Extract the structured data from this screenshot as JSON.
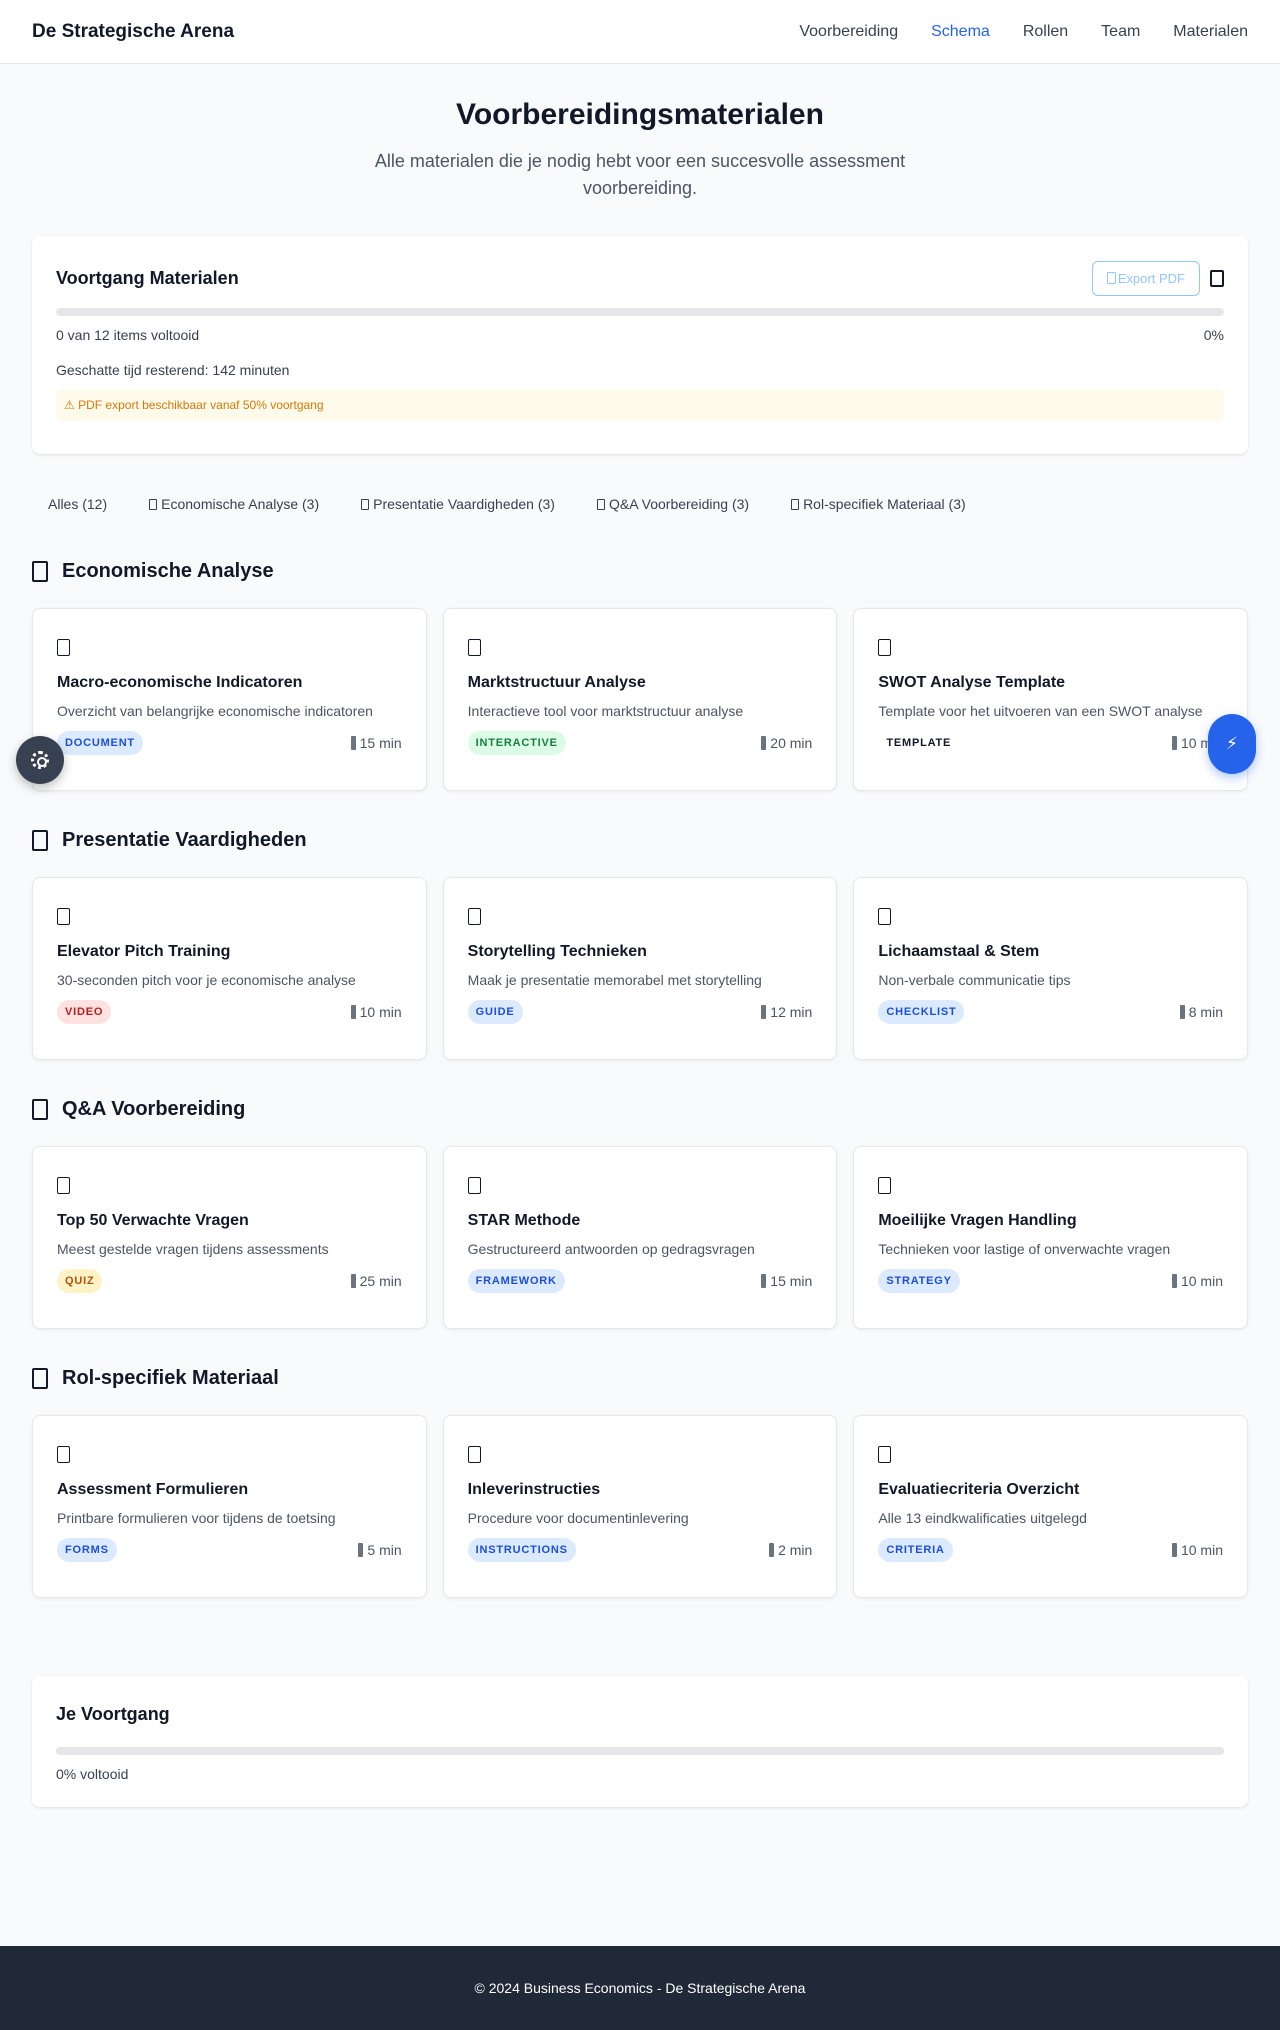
{
  "navbar": {
    "brand": "De Strategische Arena",
    "links": [
      {
        "label": "Voorbereiding"
      },
      {
        "label": "Schema"
      },
      {
        "label": "Rollen"
      },
      {
        "label": "Team"
      },
      {
        "label": "Materialen"
      }
    ],
    "active_link": "Schema"
  },
  "header": {
    "title": "Voorbereidingsmaterialen",
    "subtitle": "Alle materialen die je nodig hebt voor een succesvolle assessment voorbereiding."
  },
  "progress_panel": {
    "title": "Voortgang Materialen",
    "export_label": "Export PDF",
    "progress_fraction": 0,
    "items_text": "0 van 12 items voltooid",
    "percent_text": "0%",
    "time_text": "Geschatte tijd resterend: 142 minuten",
    "warning": "⚠ PDF export beschikbaar vanaf 50% voortgang"
  },
  "filters": [
    {
      "label": "Alles (12)",
      "icon": false
    },
    {
      "label": "Economische Analyse (3)",
      "icon": true
    },
    {
      "label": "Presentatie Vaardigheden (3)",
      "icon": true
    },
    {
      "label": "Q&A Voorbereiding (3)",
      "icon": true
    },
    {
      "label": "Rol-specifiek Materiaal (3)",
      "icon": true
    }
  ],
  "sections": [
    {
      "title": "Economische Analyse",
      "cards": [
        {
          "title": "Macro-economische Indicatoren",
          "desc": "Overzicht van belangrijke economische indicatoren",
          "badge": "DOCUMENT",
          "badge_color": "blue",
          "duration": "15 min"
        },
        {
          "title": "Marktstructuur Analyse",
          "desc": "Interactieve tool voor marktstructuur analyse",
          "badge": "INTERACTIVE",
          "badge_color": "green",
          "duration": "20 min"
        },
        {
          "title": "SWOT Analyse Template",
          "desc": "Template voor het uitvoeren van een SWOT analyse",
          "badge": "TEMPLATE",
          "badge_color": "plain",
          "duration": "10 min"
        }
      ]
    },
    {
      "title": "Presentatie Vaardigheden",
      "cards": [
        {
          "title": "Elevator Pitch Training",
          "desc": "30-seconden pitch voor je economische analyse",
          "badge": "VIDEO",
          "badge_color": "red",
          "duration": "10 min"
        },
        {
          "title": "Storytelling Technieken",
          "desc": "Maak je presentatie memorabel met storytelling",
          "badge": "GUIDE",
          "badge_color": "blue",
          "duration": "12 min"
        },
        {
          "title": "Lichaamstaal & Stem",
          "desc": "Non-verbale communicatie tips",
          "badge": "CHECKLIST",
          "badge_color": "blue",
          "duration": "8 min"
        }
      ]
    },
    {
      "title": "Q&A Voorbereiding",
      "cards": [
        {
          "title": "Top 50 Verwachte Vragen",
          "desc": "Meest gestelde vragen tijdens assessments",
          "badge": "QUIZ",
          "badge_color": "yellow",
          "duration": "25 min"
        },
        {
          "title": "STAR Methode",
          "desc": "Gestructureerd antwoorden op gedragsvragen",
          "badge": "FRAMEWORK",
          "badge_color": "blue",
          "duration": "15 min"
        },
        {
          "title": "Moeilijke Vragen Handling",
          "desc": "Technieken voor lastige of onverwachte vragen",
          "badge": "STRATEGY",
          "badge_color": "blue",
          "duration": "10 min"
        }
      ]
    },
    {
      "title": "Rol-specifiek Materiaal",
      "cards": [
        {
          "title": "Assessment Formulieren",
          "desc": "Printbare formulieren voor tijdens de toetsing",
          "badge": "FORMS",
          "badge_color": "blue",
          "duration": "5 min"
        },
        {
          "title": "Inleverinstructies",
          "desc": "Procedure voor documentinlevering",
          "badge": "INSTRUCTIONS",
          "badge_color": "blue",
          "duration": "2 min"
        },
        {
          "title": "Evaluatiecriteria Overzicht",
          "desc": "Alle 13 eindkwalificaties uitgelegd",
          "badge": "CRITERIA",
          "badge_color": "blue",
          "duration": "10 min"
        }
      ]
    }
  ],
  "summary": {
    "title": "Je Voortgang",
    "progress_fraction": 0,
    "text": "0% voltooid"
  },
  "footer": {
    "text": "© 2024 Business Economics - De Strategische Arena"
  },
  "fab_quick": {
    "glyph": "⚡"
  }
}
